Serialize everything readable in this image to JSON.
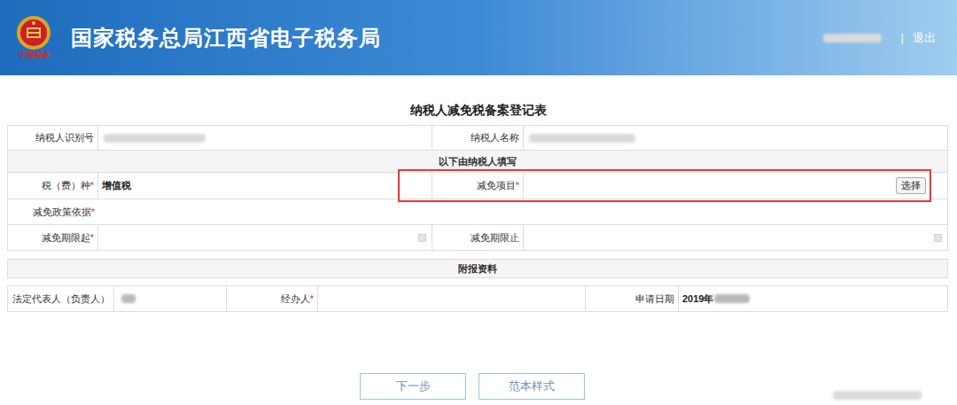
{
  "header": {
    "title": "国家税务总局江西省电子税务局",
    "emblem_text": "中国税务",
    "user_masked": true,
    "separator": "|",
    "logout": "退出"
  },
  "form": {
    "title": "纳税人减免税备案登记表",
    "required_mark": "*",
    "taxpayer": [
      {
        "label": "纳税人识别号",
        "masked": true
      },
      {
        "label": "纳税人名称",
        "masked": true
      }
    ],
    "section_fill": "以下由纳税人填写",
    "tax_type": {
      "label": "税（费）种",
      "required": true,
      "value": "增值税"
    },
    "exemption_item": {
      "label": "减免项目",
      "required": true,
      "value": "",
      "button": "选择",
      "highlighted": true
    },
    "policy_basis": {
      "label": "减免政策依据",
      "required": true,
      "value": ""
    },
    "period_start": {
      "label": "减免期限起",
      "required": true,
      "value": ""
    },
    "period_end": {
      "label": "减免期限止",
      "required": false,
      "value": ""
    },
    "section_attachments": "附报资料",
    "legal_rep": {
      "label": "法定代表人（负责人）",
      "masked": true
    },
    "handler": {
      "label": "经办人",
      "required": true,
      "value": ""
    },
    "apply_date": {
      "label": "申请日期",
      "value": "2019年",
      "masked_suffix": true
    }
  },
  "buttons": [
    {
      "label": "下一步"
    },
    {
      "label": "范本样式"
    }
  ]
}
